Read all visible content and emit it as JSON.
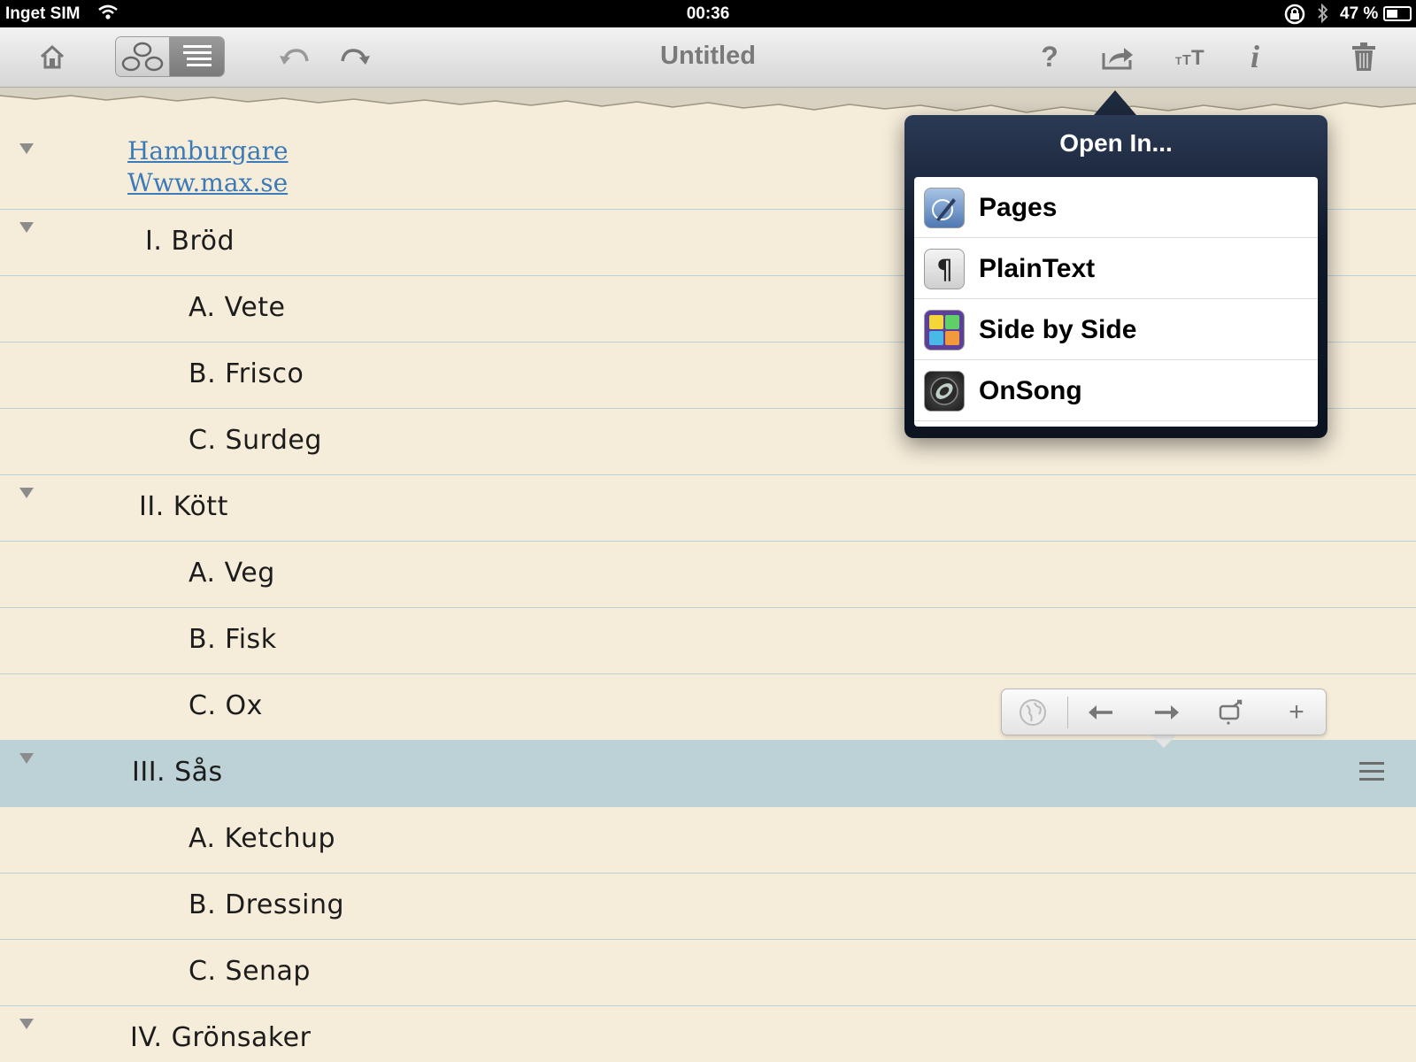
{
  "status_bar": {
    "carrier": "Inget SIM",
    "time": "00:36",
    "battery": "47 %"
  },
  "toolbar": {
    "title": "Untitled",
    "help_label": "?",
    "font_label": "TT",
    "info_label": "i"
  },
  "outline": {
    "links": [
      "Hamburgare",
      "Www.max.se"
    ],
    "rows": [
      {
        "text": "I. Bröd"
      },
      {
        "text": "A. Vete"
      },
      {
        "text": "B. Frisco"
      },
      {
        "text": "C. Surdeg"
      },
      {
        "text": "II. Kött"
      },
      {
        "text": "A. Veg"
      },
      {
        "text": "B. Fisk"
      },
      {
        "text": "C. Ox"
      },
      {
        "text": "III. Sås"
      },
      {
        "text": "A. Ketchup"
      },
      {
        "text": "B. Dressing"
      },
      {
        "text": "C. Senap"
      },
      {
        "text": "IV. Grönsaker"
      }
    ]
  },
  "open_in": {
    "title": "Open In...",
    "items": [
      {
        "label": "Pages",
        "icon": "pages-icon"
      },
      {
        "label": "PlainText",
        "icon": "pilcrow-icon"
      },
      {
        "label": "Side by Side",
        "icon": "side-by-side-icon"
      },
      {
        "label": "OnSong",
        "icon": "onsong-icon"
      }
    ]
  },
  "mini_toolbar": {
    "add_label": "+"
  }
}
